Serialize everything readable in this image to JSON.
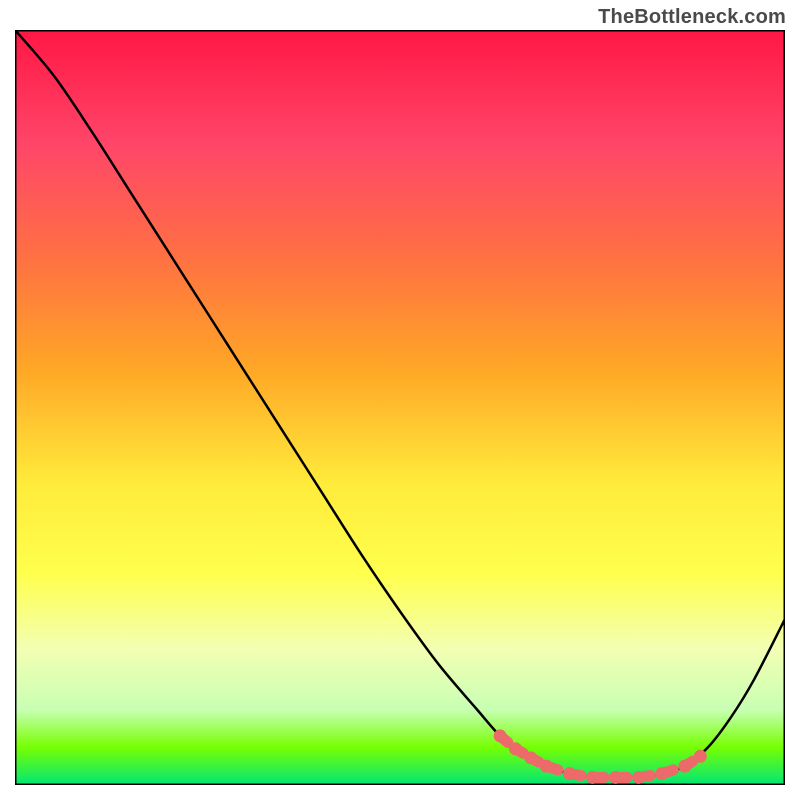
{
  "attribution": "TheBottleneck.com",
  "chart_data": {
    "type": "line",
    "title": "",
    "xlabel": "",
    "ylabel": "",
    "xlim": [
      0,
      100
    ],
    "ylim": [
      0,
      100
    ],
    "gradient_stops": [
      {
        "offset": 0.0,
        "color": "#ff1744"
      },
      {
        "offset": 0.15,
        "color": "#ff4569"
      },
      {
        "offset": 0.3,
        "color": "#ff7043"
      },
      {
        "offset": 0.45,
        "color": "#ffa726"
      },
      {
        "offset": 0.6,
        "color": "#ffeb3b"
      },
      {
        "offset": 0.72,
        "color": "#ffff4d"
      },
      {
        "offset": 0.82,
        "color": "#f3ffb3"
      },
      {
        "offset": 0.9,
        "color": "#c8ffb3"
      },
      {
        "offset": 0.95,
        "color": "#76ff03"
      },
      {
        "offset": 1.0,
        "color": "#00e676"
      }
    ],
    "series": [
      {
        "name": "bottleneck-curve",
        "color": "#000000",
        "x": [
          0,
          5,
          10,
          15,
          20,
          25,
          30,
          35,
          40,
          45,
          50,
          55,
          60,
          63,
          66,
          69,
          72,
          75,
          78,
          81,
          84,
          87,
          90,
          93,
          96,
          100
        ],
        "y": [
          100,
          94,
          86.5,
          78.5,
          70.5,
          62.5,
          54.5,
          46.5,
          38.5,
          30.5,
          23,
          16,
          10,
          6.5,
          4,
          2.5,
          1.5,
          1,
          1,
          1,
          1.5,
          2.5,
          5,
          9,
          14,
          22
        ]
      }
    ],
    "markers": {
      "name": "optimal-range-dots",
      "color": "#ec6a6a",
      "x": [
        63,
        65,
        67,
        69,
        72,
        75,
        78,
        81,
        84,
        87,
        89
      ],
      "y": [
        6.5,
        4.8,
        3.6,
        2.5,
        1.5,
        1,
        1,
        1,
        1.5,
        2.5,
        3.8
      ]
    }
  }
}
